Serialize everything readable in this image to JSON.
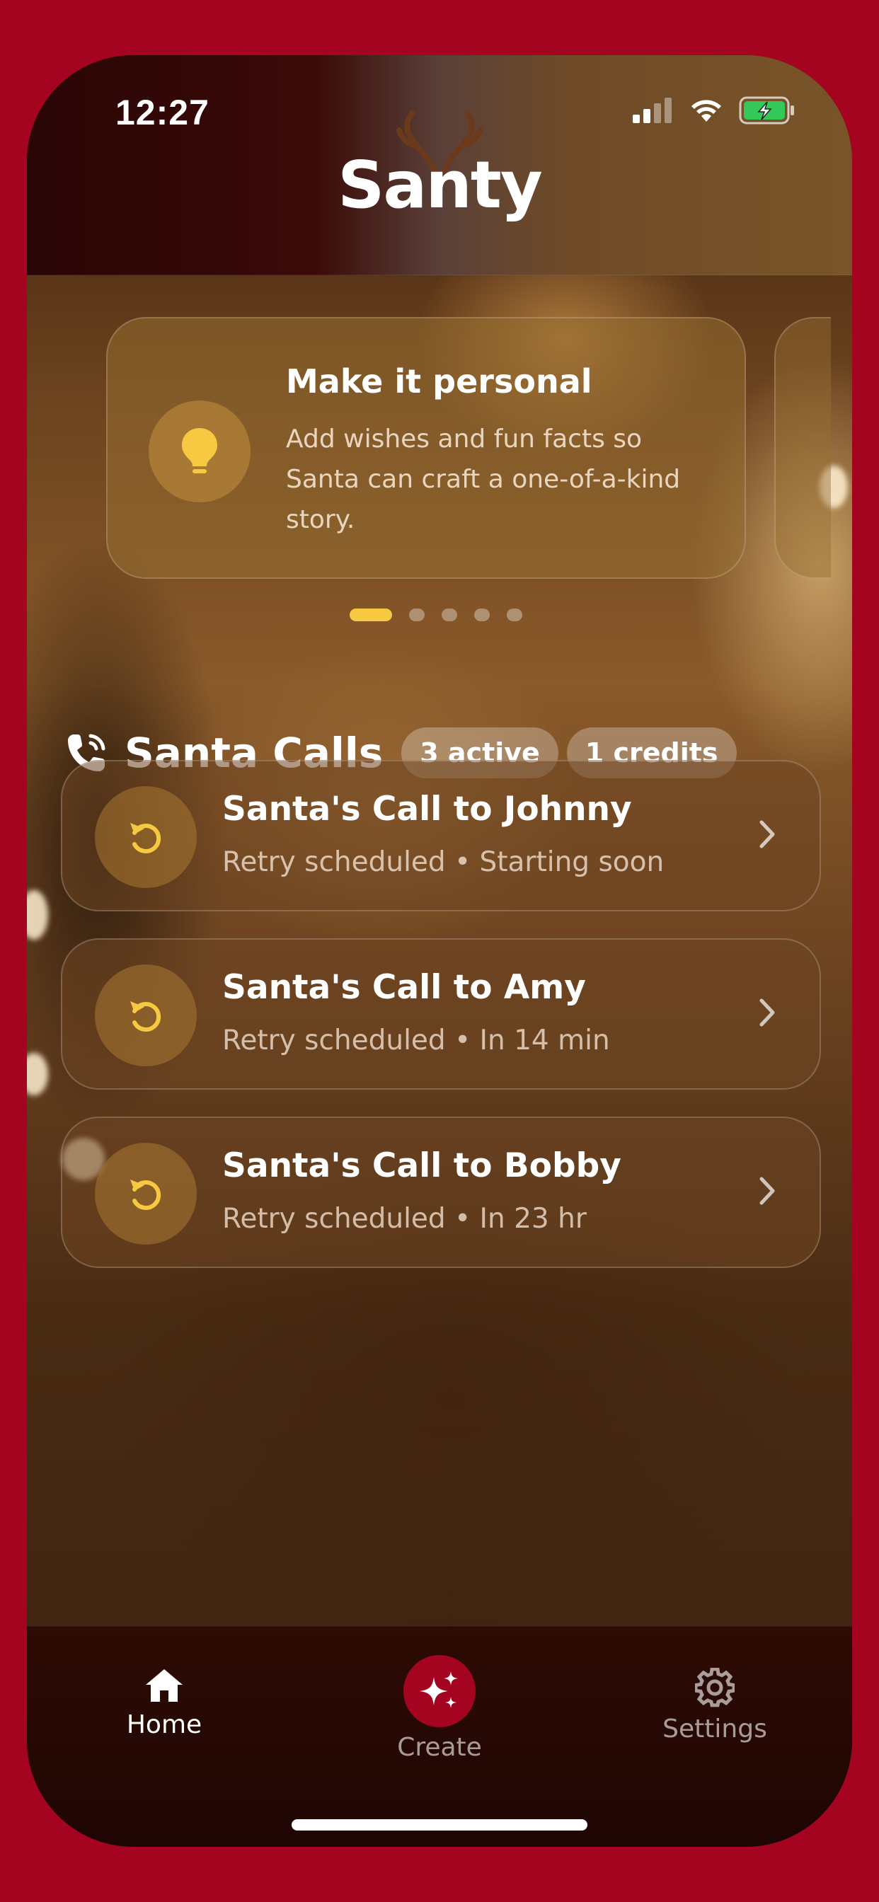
{
  "status_bar": {
    "time": "12:27"
  },
  "header": {
    "brand": "Santy"
  },
  "tip": {
    "title": "Make it personal",
    "text": "Add wishes and fun facts so Santa can craft a one-of-a-kind story.",
    "icon": "lightbulb-icon",
    "page_count": 5,
    "active_page": 1
  },
  "section": {
    "title": "Santa Calls",
    "icon": "phone-icon",
    "badges": [
      "3 active",
      "1 credits"
    ]
  },
  "calls": [
    {
      "title": "Santa's Call to Johnny",
      "subtitle": "Retry scheduled • Starting soon",
      "icon": "retry-icon"
    },
    {
      "title": "Santa's Call to Amy",
      "subtitle": "Retry scheduled • In 14 min",
      "icon": "retry-icon"
    },
    {
      "title": "Santa's Call to Bobby",
      "subtitle": "Retry scheduled • In 23 hr",
      "icon": "retry-icon"
    }
  ],
  "tabs": [
    {
      "label": "Home",
      "icon": "home-icon",
      "active": true
    },
    {
      "label": "Create",
      "icon": "sparkles-icon",
      "active": false
    },
    {
      "label": "Settings",
      "icon": "gear-icon",
      "active": false
    }
  ],
  "colors": {
    "frame": "#a50421",
    "accent": "#f7c942",
    "create_button": "#a50421"
  }
}
